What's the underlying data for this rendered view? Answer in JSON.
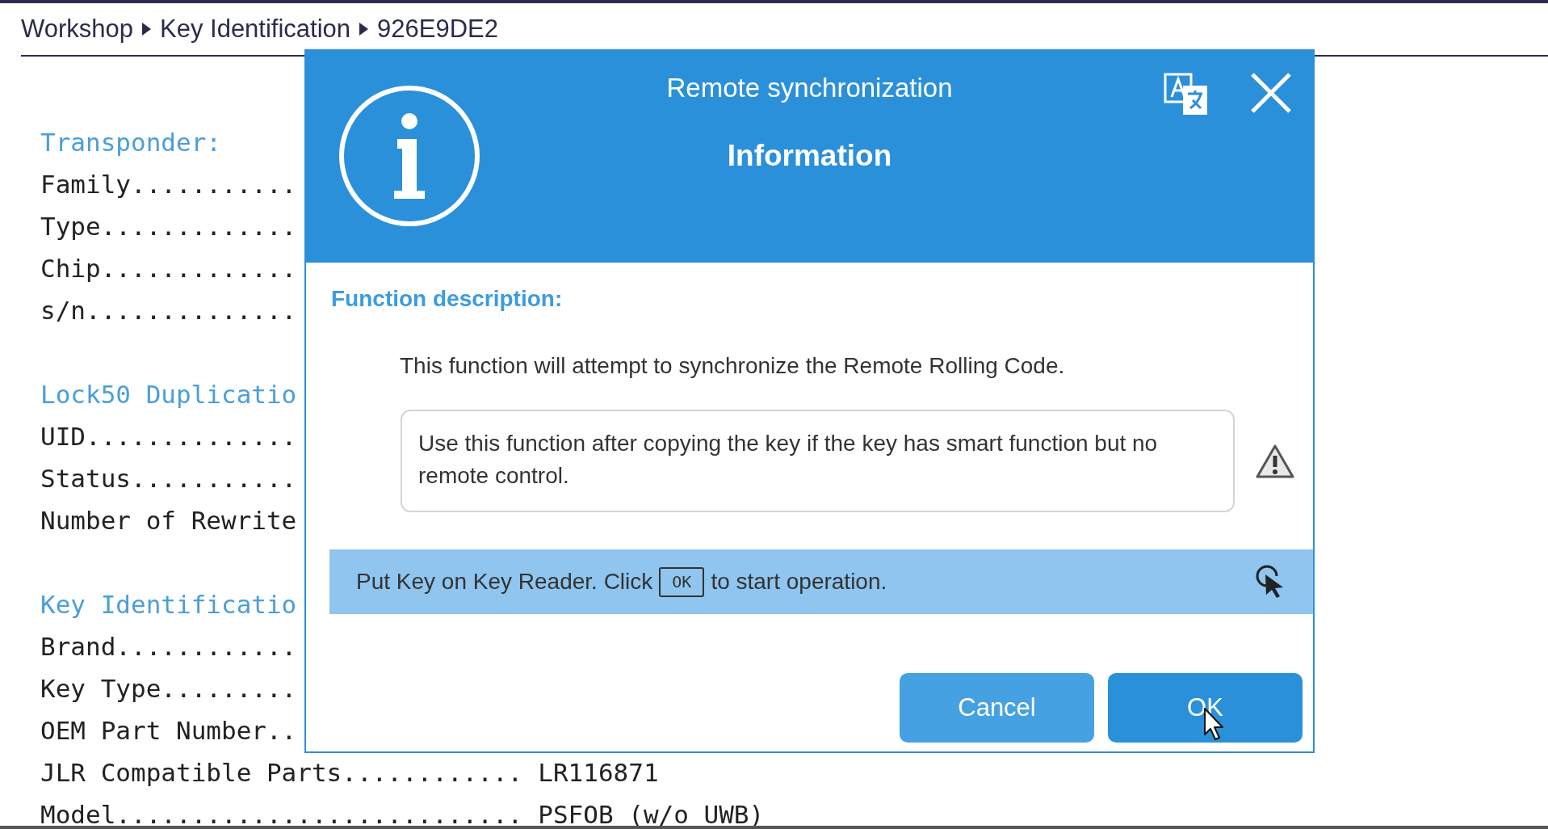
{
  "breadcrumb": [
    {
      "label": "Workshop"
    },
    {
      "label": "Key Identification"
    },
    {
      "label": "926E9DE2"
    }
  ],
  "details": [
    {
      "heading": "Transponder:",
      "rows": [
        {
          "label": "Family..........."
        },
        {
          "label": "Type............."
        },
        {
          "label": "Chip............."
        },
        {
          "label": "s/n.............."
        }
      ]
    },
    {
      "heading": "Lock50 Duplicatio",
      "rows": [
        {
          "label": "UID.............."
        },
        {
          "label": "Status..........."
        },
        {
          "label": "Number of Rewrite"
        }
      ]
    },
    {
      "heading": "Key Identificatio",
      "rows": [
        {
          "label": "Brand............"
        },
        {
          "label": "Key Type........."
        },
        {
          "label": "OEM Part Number.."
        },
        {
          "label": "JLR Compatible Parts............",
          "value": "LR116871"
        },
        {
          "label": "Model...........................",
          "value": "PSFOB (w/o UWB)"
        }
      ]
    }
  ],
  "dialog": {
    "title": "Remote synchronization",
    "subtitle": "Information",
    "section_heading": "Function description:",
    "description": "This function will attempt to synchronize the Remote Rolling Code.",
    "note": "Use this function after copying the key if the key has smart function but no remote control.",
    "instruction": {
      "before": "Put Key on Key Reader. Click",
      "key": "OK",
      "after": "to start operation."
    },
    "buttons": [
      {
        "label": "Cancel",
        "kind": "secondary"
      },
      {
        "label": "OK",
        "kind": "primary"
      }
    ]
  }
}
